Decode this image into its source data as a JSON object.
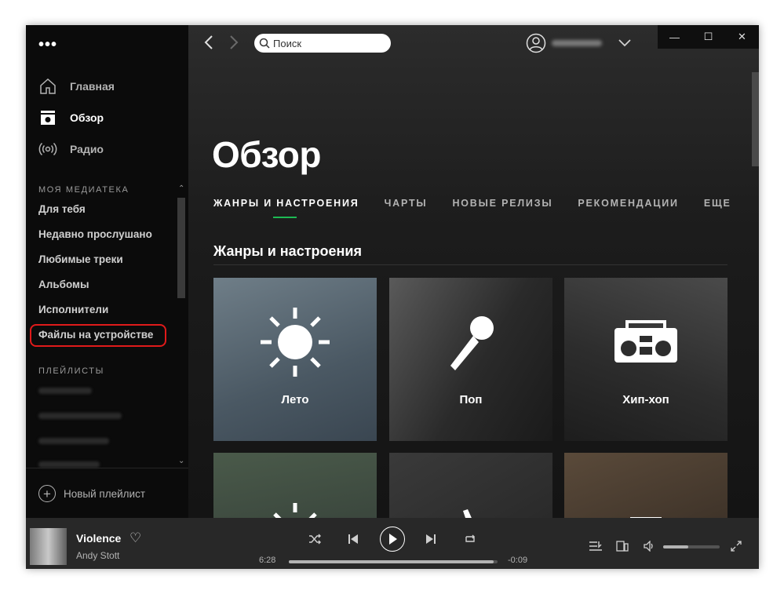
{
  "sidebar": {
    "nav": [
      {
        "label": "Главная",
        "icon": "home-icon"
      },
      {
        "label": "Обзор",
        "icon": "browse-icon"
      },
      {
        "label": "Радио",
        "icon": "radio-icon"
      }
    ],
    "library_header": "МОЯ МЕДИАТЕКА",
    "library": [
      "Для тебя",
      "Недавно прослушано",
      "Любимые треки",
      "Альбомы",
      "Исполнители",
      "Файлы на устройстве"
    ],
    "playlists_header": "ПЛЕЙЛИСТЫ",
    "new_playlist_label": "Новый плейлист"
  },
  "topbar": {
    "search_placeholder": "Поиск",
    "window_controls": [
      "—",
      "☐",
      "✕"
    ]
  },
  "page": {
    "title": "Обзор",
    "tabs": [
      "ЖАНРЫ И НАСТРОЕНИЯ",
      "ЧАРТЫ",
      "НОВЫЕ РЕЛИЗЫ",
      "РЕКОМЕНДАЦИИ",
      "ЕЩЕ"
    ],
    "section_title": "Жанры и настроения",
    "tiles": [
      {
        "label": "Лето",
        "icon": "sun-icon"
      },
      {
        "label": "Поп",
        "icon": "microphone-icon"
      },
      {
        "label": "Хип-хоп",
        "icon": "boombox-icon"
      },
      {
        "label": "",
        "icon": "sunset-icon"
      },
      {
        "label": "",
        "icon": "microphone-icon"
      },
      {
        "label": "",
        "icon": "amplifier-icon"
      }
    ]
  },
  "player": {
    "track": "Violence",
    "artist": "Andy Stott",
    "elapsed": "6:28",
    "remaining": "-0:09",
    "progress": 0.98,
    "volume": 0.45
  },
  "colors": {
    "accent": "#1db954",
    "highlight": "#e01a1a"
  }
}
